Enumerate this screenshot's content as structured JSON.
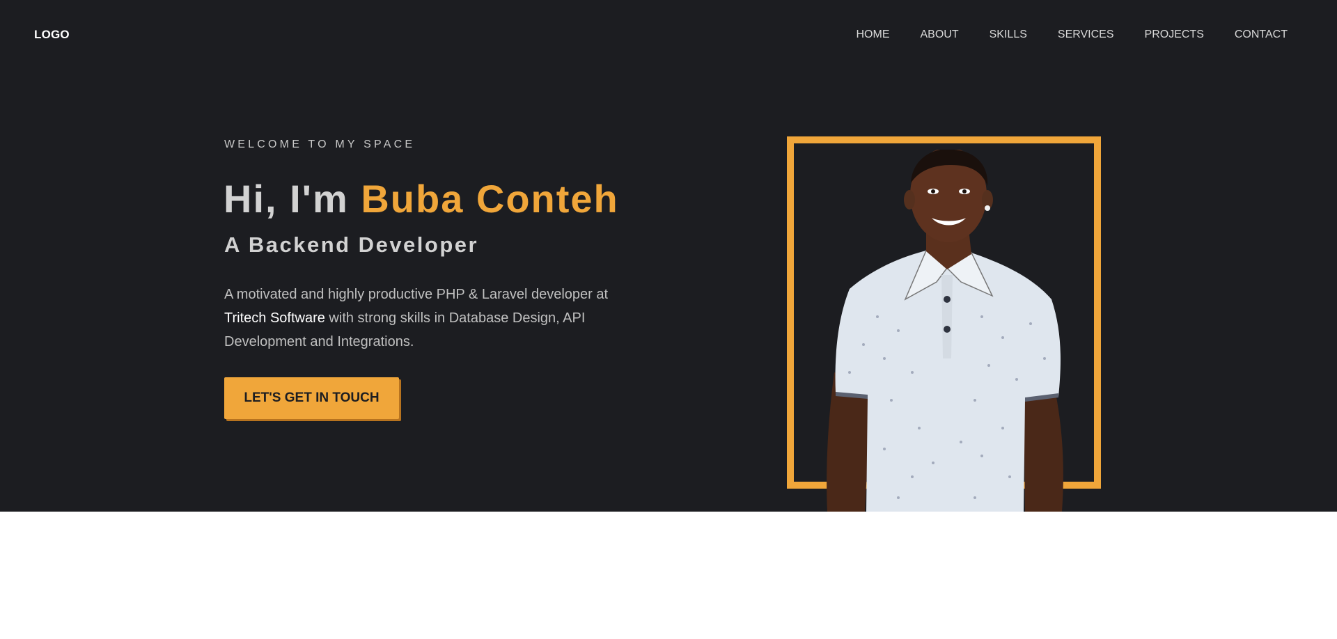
{
  "header": {
    "logo": "LOGO",
    "nav": [
      "HOME",
      "ABOUT",
      "SKILLS",
      "SERVICES",
      "PROJECTS",
      "CONTACT"
    ]
  },
  "hero": {
    "welcome": "WELCOME TO MY SPACE",
    "greeting": "Hi, I'm ",
    "name": "Buba Conteh",
    "role": "A Backend Developer",
    "desc_part1": "A motivated and highly productive PHP & Laravel developer at ",
    "desc_company": "Tritech Software",
    "desc_part2": " with strong skills in Database Design, API Development and Integrations.",
    "cta": "LET'S GET IN TOUCH"
  },
  "colors": {
    "background": "#1c1d21",
    "accent": "#f0a63a",
    "text": "#d2d2d2"
  },
  "icons": {
    "portrait": "profile-photo"
  }
}
